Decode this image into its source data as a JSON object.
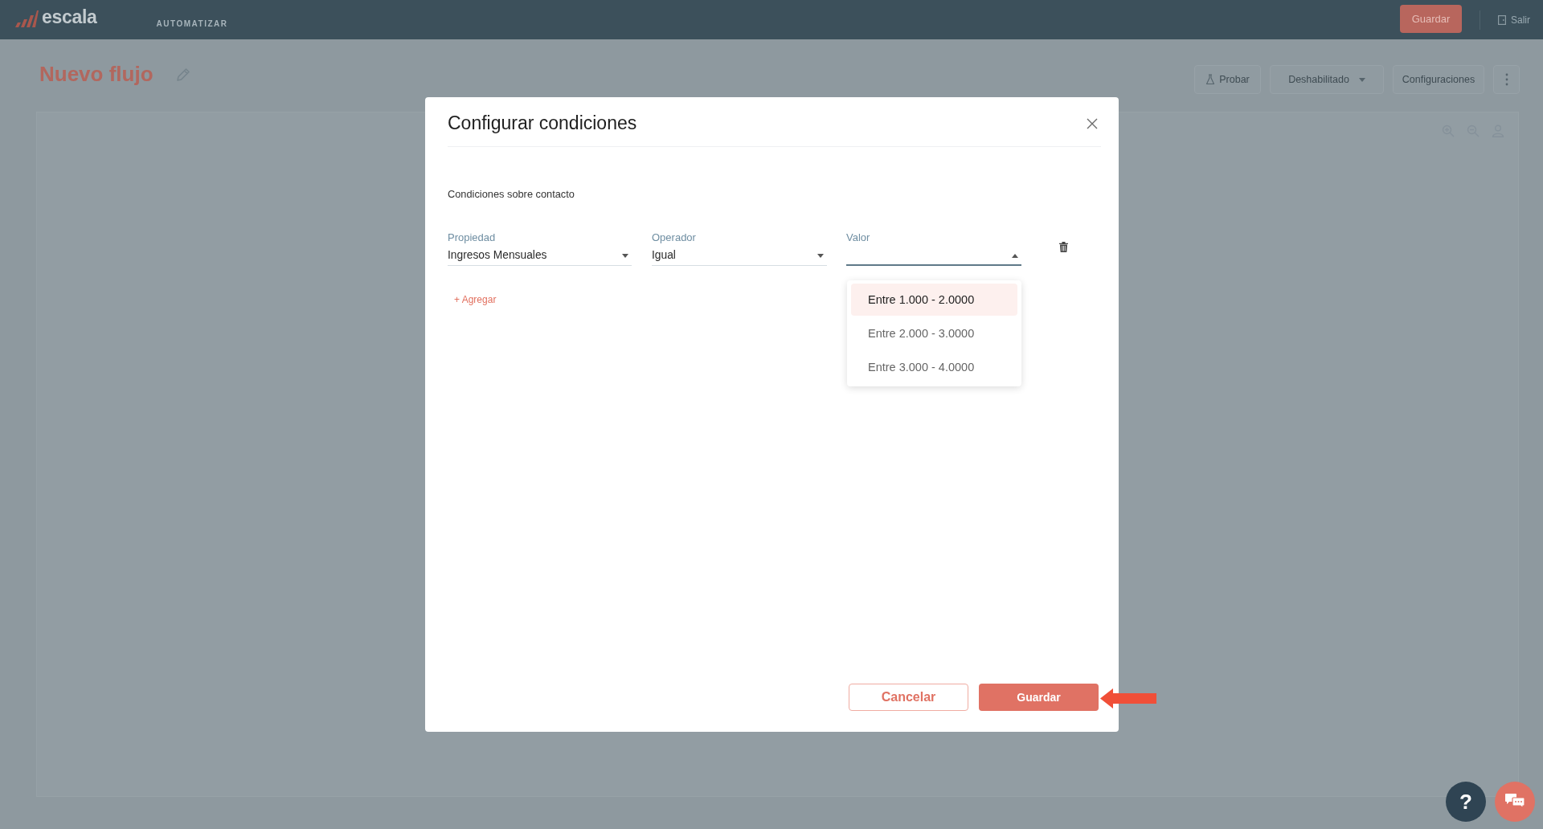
{
  "header": {
    "logo": "escala",
    "section": "AUTOMATIZAR",
    "save_button": "Guardar",
    "exit_button": "Salir"
  },
  "page": {
    "title": "Nuevo flujo",
    "toolbar": [
      {
        "kind": "test",
        "label": "Probar"
      },
      {
        "kind": "dropdown",
        "label": "Deshabilitado"
      },
      {
        "kind": "plain",
        "label": "Configuraciones"
      },
      {
        "kind": "more"
      }
    ]
  },
  "modal": {
    "title": "Configurar condiciones",
    "section_label": "Condiciones sobre contacto",
    "fields": [
      {
        "label": "Propiedad",
        "value": "Ingresos Mensuales",
        "expanded": false
      },
      {
        "label": "Operador",
        "value": "Igual",
        "expanded": false
      },
      {
        "label": "Valor",
        "expanded": true,
        "options": [
          {
            "label": "Entre 1.000 - 2.0000",
            "selected": true
          },
          {
            "label": "Entre 2.000 - 3.0000",
            "selected": false
          },
          {
            "label": "Entre 3.000 - 4.0000",
            "selected": false
          }
        ]
      }
    ],
    "add_link": "+ Agregar",
    "buttons": [
      {
        "kind": "secondary",
        "label": "Cancelar"
      },
      {
        "kind": "primary",
        "label": "Guardar"
      }
    ]
  },
  "floating_buttons": [
    {
      "kind": "help",
      "label": "?"
    },
    {
      "kind": "chat"
    }
  ]
}
